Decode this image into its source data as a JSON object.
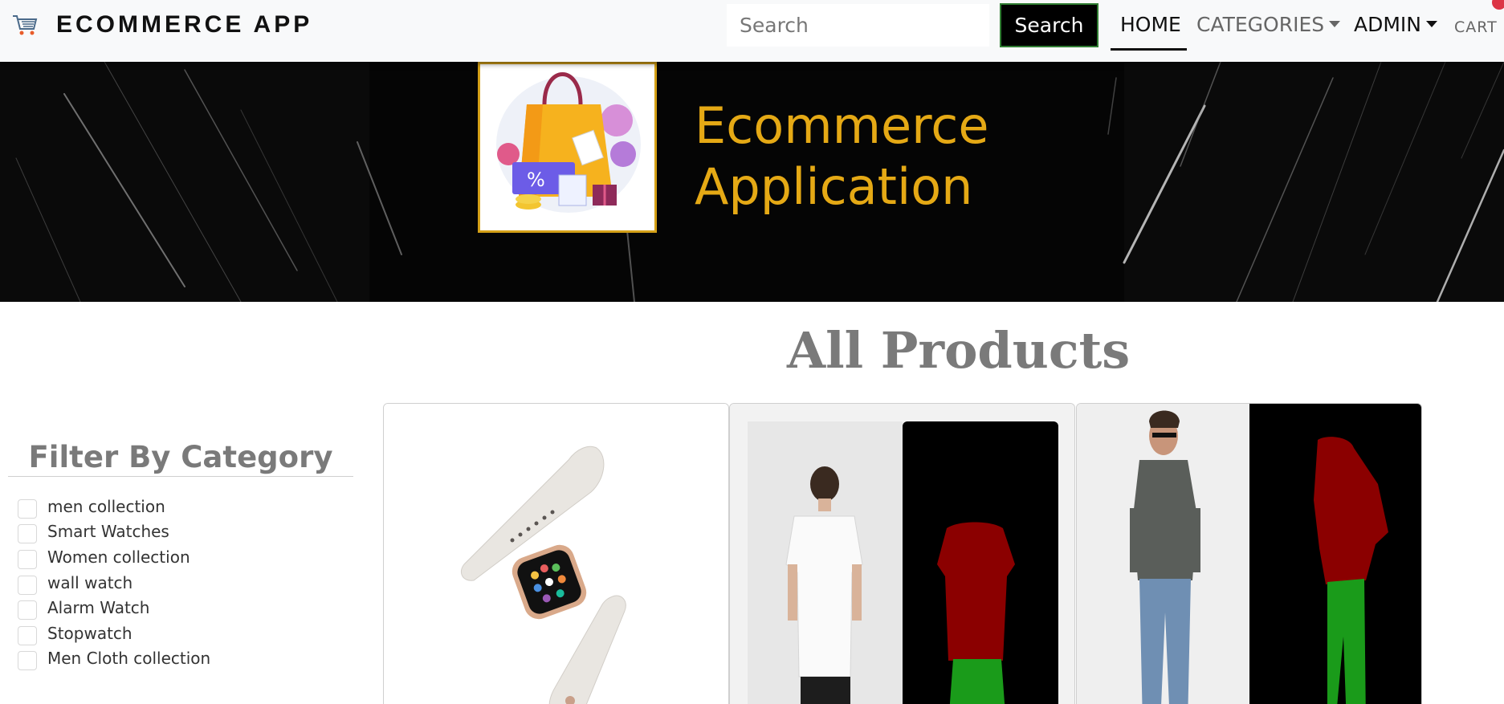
{
  "navbar": {
    "brand": "ECOMMERCE APP",
    "search_placeholder": "Search",
    "search_button": "Search",
    "links": {
      "home": "HOME",
      "categories": "CATEGORIES",
      "admin": "ADMIN",
      "cart": "CART"
    }
  },
  "banner": {
    "title_line1": "Ecommerce",
    "title_line2": "Application",
    "logo_badge": "%"
  },
  "main": {
    "heading": "All Products"
  },
  "filter": {
    "title": "Filter By Category",
    "categories": [
      "men collection",
      "Smart Watches",
      "Women collection",
      "wall watch",
      "Alarm Watch",
      "Stopwatch",
      "Men Cloth collection"
    ]
  },
  "products": [
    {
      "image": "smartwatch-with-strap"
    },
    {
      "image": "white-tshirt-segmentation"
    },
    {
      "image": "grey-shirt-jeans-segmentation"
    }
  ],
  "colors": {
    "navbar_bg": "#f8f9fa",
    "banner_title": "#e5a915",
    "cart_badge": "#dc3545",
    "segmentation_top": "#8b0000",
    "segmentation_bottom": "#1a9b1a"
  }
}
